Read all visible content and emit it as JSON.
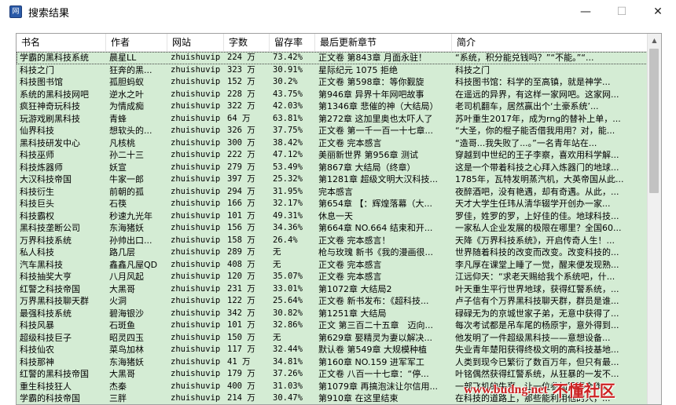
{
  "window": {
    "title": "搜索结果",
    "minimize": "—",
    "maximize": "☐",
    "close": "✕",
    "app_icon_glyph": "网"
  },
  "table": {
    "headers": [
      "书名",
      "作者",
      "网站",
      "字数",
      "留存率",
      "最后更新章节",
      "简介"
    ],
    "rows": [
      [
        "学霸的黑科技系统",
        "晨星LL",
        "zhuishuvip",
        "224 万",
        "73.42%",
        "正文卷 第843章 月面永驻！",
        "“系统，积分能兑钱吗？”“不能。”“..."
      ],
      [
        "科技之门",
        "狂奔的黑...",
        "zhuishuvip",
        "323 万",
        "30.91%",
        "星际纪元 1075 拒绝",
        "科技之门"
      ],
      [
        "科技图书馆",
        "孤胆蚂蚁",
        "zhuishuvip",
        "152 万",
        "30.2%",
        "正文卷 第598章：等你觐旋",
        "科技图书馆：科学的至高镇，就是神学..."
      ],
      [
        "系统的黑科技网吧",
        "逆水之叶",
        "zhuishuvip",
        "228 万",
        "43.75%",
        "第946章 异界十年网吧故事",
        "在遥远的异界，有这样一家网吧。这家网..."
      ],
      [
        "疯狂神奇玩科技",
        "为情成痴",
        "zhuishuvip",
        "322 万",
        "42.03%",
        "第1346章 悲催的神（大结局）",
        "老司机翻车，居然赢出个‘土豪系统’..."
      ],
      [
        "玩游戏刷黑科技",
        "青蜂",
        "zhuishuvip",
        "64 万",
        "63.81%",
        "第272章 这加里奥也太吓人了",
        "苏叶重生2017年，成为rng的替补上单，..."
      ],
      [
        "仙界科技",
        "想软头的...",
        "zhuishuvip",
        "326 万",
        "37.75%",
        "正文卷 第一千一百一十七章...",
        "“大圣，你的棍子能否借我用用？对，能..."
      ],
      [
        "黑科技研发中心",
        "凡核桃",
        "zhuishuvip",
        "300 万",
        "38.42%",
        "正文卷 完本感言",
        "“造哥...我失败了...。”一名青年站在..."
      ],
      [
        "科技巫师",
        "孙二十三",
        "zhuishuvip",
        "222 万",
        "47.12%",
        "美丽新世界 第956章 测试",
        "穿越到中世纪的王子李察，喜欢用科学解..."
      ],
      [
        "科技炼器师",
        "妖宣",
        "zhuishuvip",
        "279 万",
        "53.49%",
        "第867章 大结局（终章）",
        "这是一个带着科技之心拜入炼器门的地球..."
      ],
      [
        "大汉科技帝国",
        "牛家一郎",
        "zhuishuvip",
        "397 万",
        "25.32%",
        "第1281章 超级文明大汉科技...",
        "1785年，瓦特发明蒸汽机，大英帝国从此..."
      ],
      [
        "科技衍生",
        "前朝的孤",
        "zhuishuvip",
        "294 万",
        "31.95%",
        "完本感言",
        "夜醉酒吧，没有艳遇，却有奇遇。从此，..."
      ],
      [
        "科技巨头",
        "石筷",
        "zhuishuvip",
        "166 万",
        "32.17%",
        "第654章 【：辉煌落幕（大...",
        "天才大学生任玮从清华辍学开创办一家..."
      ],
      [
        "科技霸权",
        "秒速九光年",
        "zhuishuvip",
        "101 万",
        "49.31%",
        "休息一天",
        "罗佳，姓罗的罗，上好佳的佳。地球科技..."
      ],
      [
        "黑科技垄断公司",
        "东海猪妖",
        "zhuishuvip",
        "156 万",
        "34.36%",
        "第664章 NO.664 结束和开...",
        "一家私人企业发展的极限在哪里？全国60..."
      ],
      [
        "万界科技系统",
        "孙帅出口...",
        "zhuishuvip",
        "158 万",
        "26.4%",
        "正文卷 完本感言！",
        "天降《万界科技系统》，开启传奇人生！..."
      ],
      [
        "私人科技",
        "路几层",
        "zhuishuvip",
        "289 万",
        "无",
        "枪与玫瑰 新书《我的漫画很...",
        "世界随着科技的改变而改变。改变科技的..."
      ],
      [
        "汽车黑科技",
        "鑫鑫凡屋QD",
        "zhuishuvip",
        "408 万",
        "无",
        "正文卷 完本感言",
        "李凡厚在课堂上睡了一觉，醒来便发现熟..."
      ],
      [
        "科技抽奖大亨",
        "八月风起",
        "zhuishuvip",
        "120 万",
        "35.07%",
        "正文卷 完本感言",
        "江远仰天：“求老天赐给我个系统吧，什..."
      ],
      [
        "红警之科技帝国",
        "大黑哥",
        "zhuishuvip",
        "231 万",
        "33.01%",
        "第1072章 大结局2",
        "叶天重生平行世界地球，获得红警系统，..."
      ],
      [
        "万界黑科技聊天群",
        "火洞",
        "zhuishuvip",
        "122 万",
        "25.64%",
        "正文卷 新书发布：《超科技...",
        "卢子信有个万界黑科技聊天群，群员是谁..."
      ],
      [
        "最强科技系统",
        "碧海银沙",
        "zhuishuvip",
        "342 万",
        "30.82%",
        "第1251章 大结局",
        "碌碌无为的京城世家子弟，无意中获得了..."
      ],
      [
        "科技风暴",
        "石斑鱼",
        "zhuishuvip",
        "101 万",
        "32.86%",
        "正文 第三百二十五章　迈向...",
        "每次考试都是吊车尾的杨原宇，意外得到..."
      ],
      [
        "超级科技巨子",
        "昭灵四玉",
        "zhuishuvip",
        "150 万",
        "无",
        "第629章 娶精灵为妻以解决...",
        "他发明了一件超级黑科技——意想设备..."
      ],
      [
        "科技仙农",
        "菜鸟加林",
        "zhuishuvip",
        "117 万",
        "32.44%",
        "默认卷 第549章 大规模种植",
        "失业青年楚阳获得终极文明的高科技基地..."
      ],
      [
        "科技那神",
        "东海猪妖",
        "zhuishuvip",
        "41 万",
        "34.81%",
        "第160章 NO.159 进军军工",
        "人类到现今已繁衍了数百万年，但只有最..."
      ],
      [
        "红警的黑科技帝国",
        "大黑哥",
        "zhuishuvip",
        "179 万",
        "37.26%",
        "正文卷 八百一十七章：“停...",
        "叶铭偶然获得红警系统，从狂暴的一发不..."
      ],
      [
        "重生科技狂人",
        "杰秦",
        "zhuishuvip",
        "400 万",
        "31.03%",
        "第1079章 再搞泡沫让尔信用...",
        "一部飞机的失事，让一位参加军事合作..."
      ],
      [
        "学霸的科技帝国",
        "三胖",
        "zhuishuvip",
        "214 万",
        "30.47%",
        "第910章 在这里结束",
        "在科技的道路上，那些能利用他的人，..."
      ]
    ]
  },
  "watermark": {
    "url": "www.budng.net",
    "label": "不懂社区"
  }
}
